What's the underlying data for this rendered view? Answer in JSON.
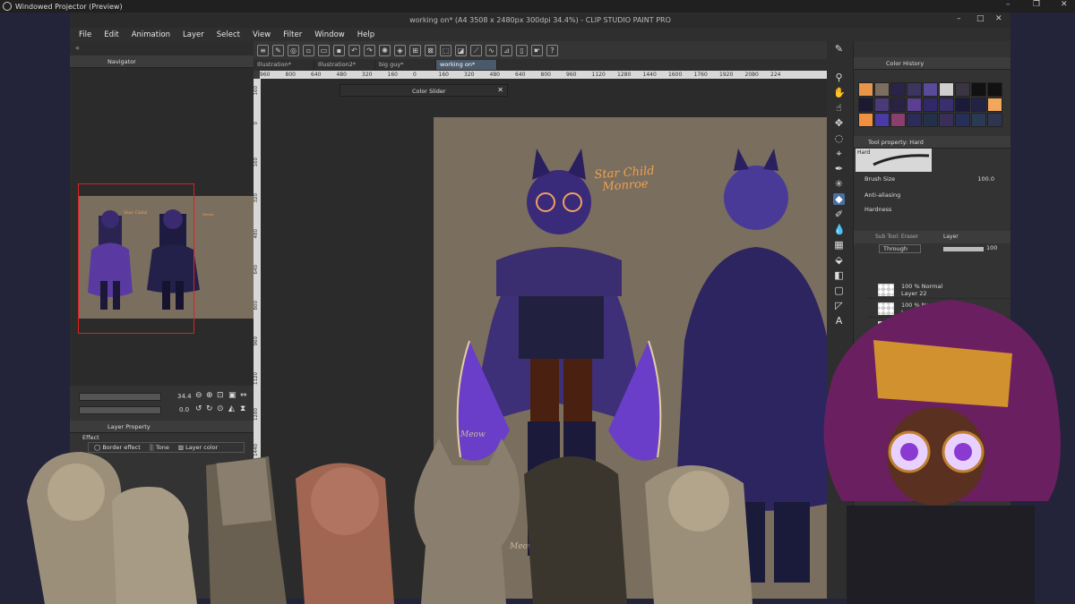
{
  "projector": {
    "title": "Windowed Projector (Preview)"
  },
  "window": {
    "title": "working on* (A4 3508 x 2480px 300dpi 34.4%) - CLIP STUDIO PAINT PRO",
    "controls": [
      "–",
      "□",
      "✕"
    ]
  },
  "menu": [
    "File",
    "Edit",
    "Animation",
    "Layer",
    "Select",
    "View",
    "Filter",
    "Window",
    "Help"
  ],
  "navigator": {
    "title": "Navigator",
    "zoom": "34.4",
    "rotation": "0.0"
  },
  "layer_property": {
    "title": "Layer Property",
    "effect_label": "Effect",
    "buttons": [
      "Border effect",
      "Tone",
      "Layer color"
    ]
  },
  "canvas_tabs": [
    "Illustration*",
    "Illustration2*",
    "big guy*",
    "working on*"
  ],
  "ruler_h": [
    "960",
    "800",
    "640",
    "480",
    "320",
    "160",
    "0",
    "160",
    "320",
    "480",
    "640",
    "800",
    "960",
    "1120",
    "1280",
    "1440",
    "1600",
    "1760",
    "1920",
    "2080",
    "224"
  ],
  "ruler_v": [
    "160",
    "0",
    "160",
    "320",
    "480",
    "640",
    "800",
    "960",
    "1120",
    "1280",
    "1440",
    "1600",
    "1760",
    "1920"
  ],
  "color_slider": {
    "title": "Color Slider"
  },
  "artwork": {
    "signature_line1": "Star Child",
    "signature_line2": "Monroe",
    "watermark_1": "Meow",
    "watermark_2": "Meow"
  },
  "color_history": {
    "title": "Color History",
    "swatches": [
      "#e8954a",
      "#7a6e5e",
      "#2a2548",
      "#3b3560",
      "#5a4a9a",
      "#cfcfcf",
      "#3a3540",
      "#111111",
      "#111111",
      "#1b1a33",
      "#4b3a78",
      "#2a2244",
      "#5b3f92",
      "#31286a",
      "#3a2f6e",
      "#1a1a3a",
      "#222244",
      "#f2a85a",
      "#f09040",
      "#4a3aa8",
      "#8a3f6e",
      "#2c2c5a",
      "#22304a",
      "#3a2f5a",
      "#24305a",
      "#2a3a55",
      "#2f3550"
    ]
  },
  "tool_property": {
    "title": "Tool property: Hard",
    "brush_name": "Hard",
    "brush_size_label": "Brush Size",
    "brush_size_value": "100.0",
    "anti_aliasing_label": "Anti-aliasing",
    "hardness_label": "Hardness"
  },
  "layer_panel": {
    "sub_tool_tab": "Sub Tool: Eraser",
    "layer_tab": "Layer",
    "blend_mode": "Through",
    "opacity": "100",
    "layers": [
      {
        "mode": "100 % Normal",
        "name": "Layer 22"
      },
      {
        "mode": "100 % Normal",
        "name": "Layer 10"
      },
      {
        "mode": "100 % No",
        "name": ""
      }
    ]
  }
}
